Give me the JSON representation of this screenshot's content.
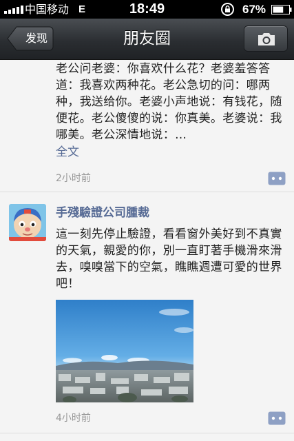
{
  "status_bar": {
    "carrier": "中国移动",
    "network": "E",
    "time": "18:49",
    "battery": "67%",
    "battery_level": 0.67
  },
  "nav": {
    "back_label": "发现",
    "title": "朋友圈",
    "icons": {
      "camera": "camera-icon",
      "back": "chevron-left-icon"
    }
  },
  "feed": {
    "posts": [
      {
        "text": "老公问老婆：你喜欢什么花？老婆羞答答道：我喜欢两种花。老公急切的问：哪两种，我送给你。老婆小声地说：有钱花，随便花。老公傻傻的说：你真美。老婆说：我哪美。老公深情地说：…",
        "expand_label": "全文",
        "time": "2小时前",
        "action_icon": "comment-icon"
      },
      {
        "author": "手殘驗證公司腫裁",
        "text": "這一刻先停止驗證，看看窗外美好到不真實的天氣，親愛的你，別一直盯著手機滑來滑去，嗅嗅當下的空氣，瞧瞧週遭可愛的世界吧！",
        "time": "4小时前",
        "avatar_icon": "cartoon-avatar",
        "photo": "city-sky-photo",
        "action_icon": "comment-icon"
      }
    ]
  },
  "colors": {
    "link": "#576b95",
    "nav_bg": "#2b2e32",
    "feed_bg": "#f4f4f4",
    "time_gray": "#999999"
  }
}
